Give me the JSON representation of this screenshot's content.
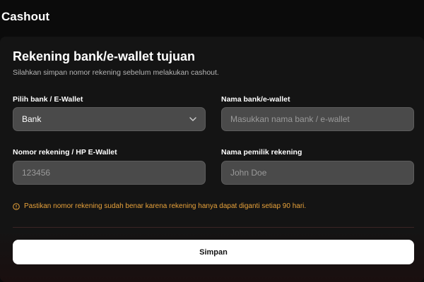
{
  "header": {
    "title": "Cashout"
  },
  "form": {
    "title": "Rekening bank/e-wallet tujuan",
    "subtitle": "Silahkan simpan nomor rekening sebelum melakukan cashout.",
    "bank_select": {
      "label": "Pilih bank / E-Wallet",
      "value": "Bank"
    },
    "bank_name": {
      "label": "Nama bank/e-wallet",
      "placeholder": "Masukkan nama bank / e-wallet"
    },
    "account_number": {
      "label": "Nomor rekening / HP E-Wallet",
      "placeholder": "123456"
    },
    "account_owner": {
      "label": "Nama pemilik rekening",
      "placeholder": "John Doe"
    },
    "notice": "Pastikan nomor rekening sudah benar karena rekening hanya dapat diganti setiap 90 hari.",
    "save_label": "Simpan"
  },
  "colors": {
    "background": "#0b0b0b",
    "card": "#141414",
    "input": "#4a4a4a",
    "warning": "#e8a23a",
    "button": "#ffffff"
  },
  "icons": {
    "select": "chevron-down-icon",
    "notice": "info-icon"
  }
}
